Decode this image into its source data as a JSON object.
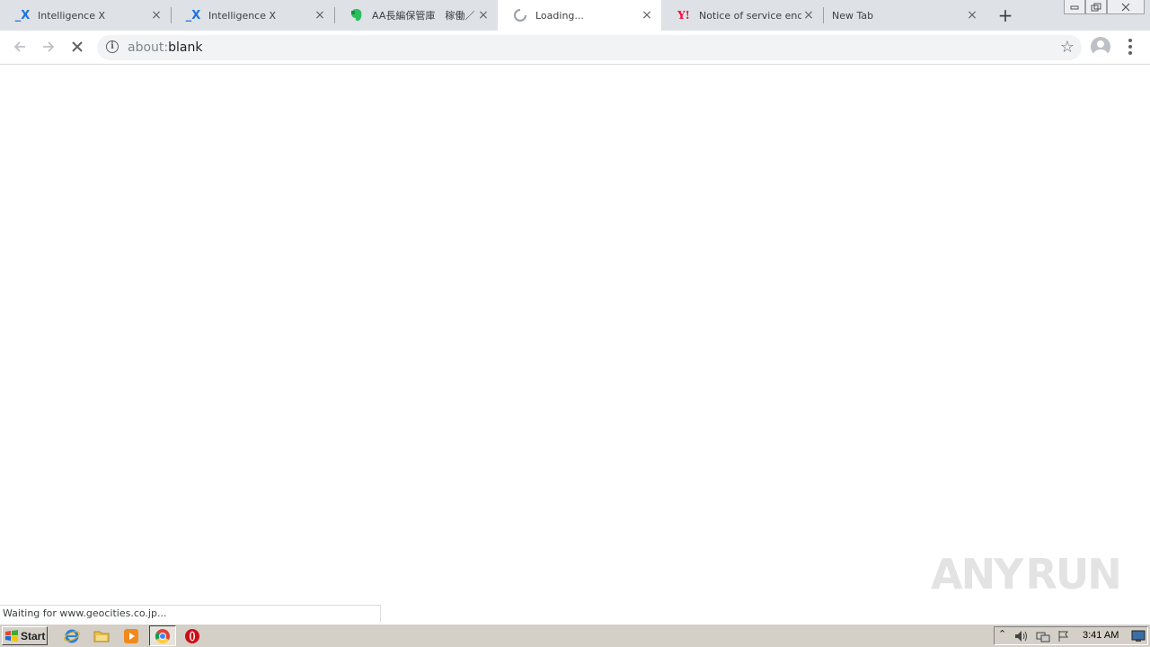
{
  "browser": {
    "tabs": [
      {
        "title": "Intelligence X",
        "favicon": "x-logo-icon",
        "active": false
      },
      {
        "title": "Intelligence X",
        "favicon": "x-logo-icon",
        "active": false
      },
      {
        "title": "AA長編保管庫　稼働／｜",
        "favicon": "evernote-icon",
        "active": false
      },
      {
        "title": "Loading...",
        "favicon": "loading-spinner-icon",
        "active": true
      },
      {
        "title": "Notice of service end",
        "favicon": "yahoo-y-icon",
        "active": false
      },
      {
        "title": "New Tab",
        "favicon": "",
        "active": false
      }
    ],
    "tab_close_glyph": "×",
    "new_tab_glyph": "+",
    "address_bar": {
      "scheme": "about:",
      "rest": "blank"
    },
    "status_text": "Waiting for www.geocities.co.jp..."
  },
  "watermark": {
    "left": "ANY",
    "right": "RUN"
  },
  "taskbar": {
    "start_label": "Start",
    "clock": "3:41 AM"
  },
  "colors": {
    "tabstrip": "#dee1e6",
    "x_logo": "#1a73e8",
    "evernote": "#2dbe60",
    "yahoo": "#ff0033",
    "opera": "#cc0f16",
    "taskbar": "#d4d0c8"
  }
}
